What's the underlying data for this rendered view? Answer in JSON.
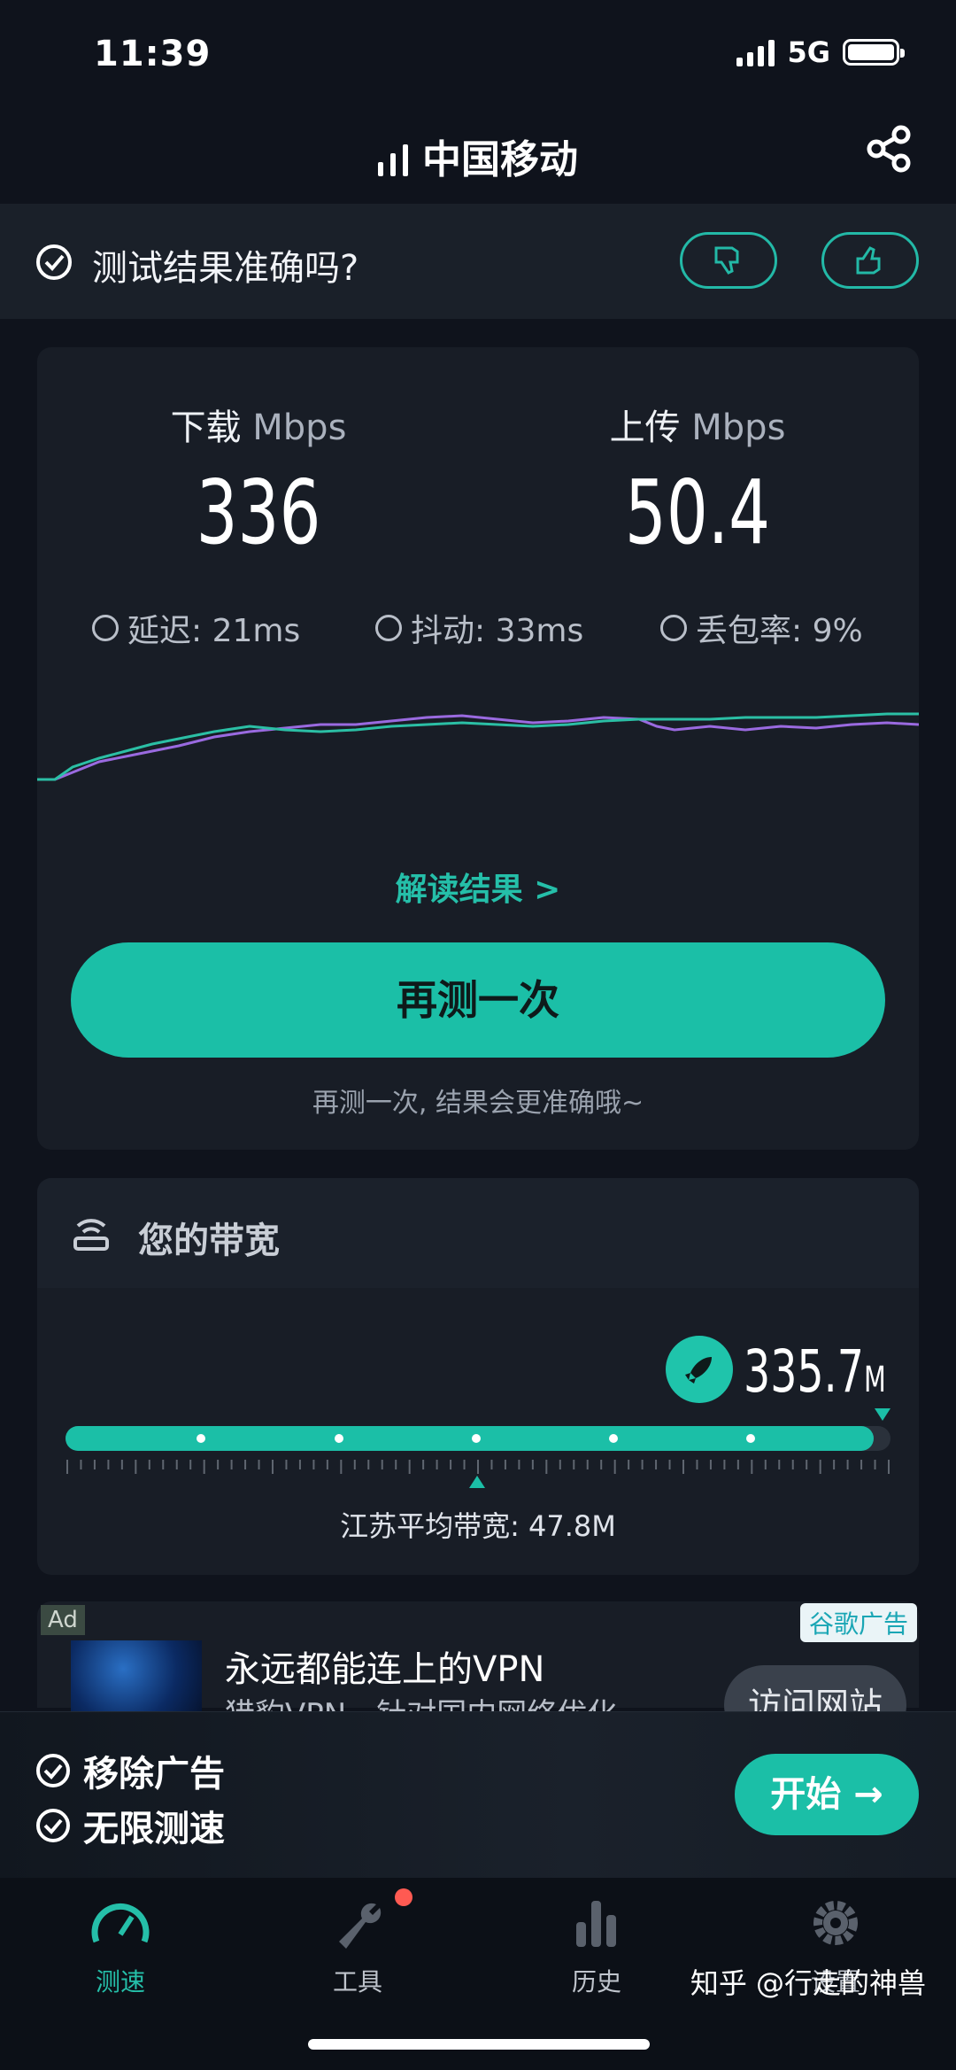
{
  "status": {
    "time": "11:39",
    "network": "5G"
  },
  "header": {
    "carrier": "中国移动"
  },
  "feedback": {
    "question": "测试结果准确吗?"
  },
  "result": {
    "download_label": "下载",
    "upload_label": "上传",
    "unit": "Mbps",
    "download_value": "336",
    "upload_value": "50.4",
    "latency": "延迟: 21ms",
    "jitter": "抖动: 33ms",
    "packet_loss": "丢包率: 9%",
    "interpret_link": "解读结果 >",
    "retest_button": "再测一次",
    "retest_hint": "再测一次, 结果会更准确哦~"
  },
  "bandwidth": {
    "title": "您的带宽",
    "value": "335.7",
    "value_unit": "M",
    "average_text": "江苏平均带宽: 47.8M",
    "fill_fraction": 0.98
  },
  "ad": {
    "tag": "Ad",
    "provider": "谷歌广告",
    "title": "永远都能连上的VPN",
    "subtitle": "猎豹VPN，针对国内网络优化",
    "button": "访问网站"
  },
  "promo": {
    "item1": "移除广告",
    "item2": "无限测速",
    "start_button": "开始 →"
  },
  "nav": {
    "items": [
      {
        "label": "测速",
        "icon": "speedometer-icon",
        "active": true
      },
      {
        "label": "工具",
        "icon": "wrench-icon",
        "active": false
      },
      {
        "label": "历史",
        "icon": "bar-chart-icon",
        "active": false
      },
      {
        "label": "设置",
        "icon": "gear-icon",
        "active": false
      }
    ]
  },
  "watermark": "知乎 @行走的神兽",
  "colors": {
    "accent": "#1bbfa7",
    "download_line": "#2bbfa5",
    "upload_line": "#9a6ae0"
  }
}
